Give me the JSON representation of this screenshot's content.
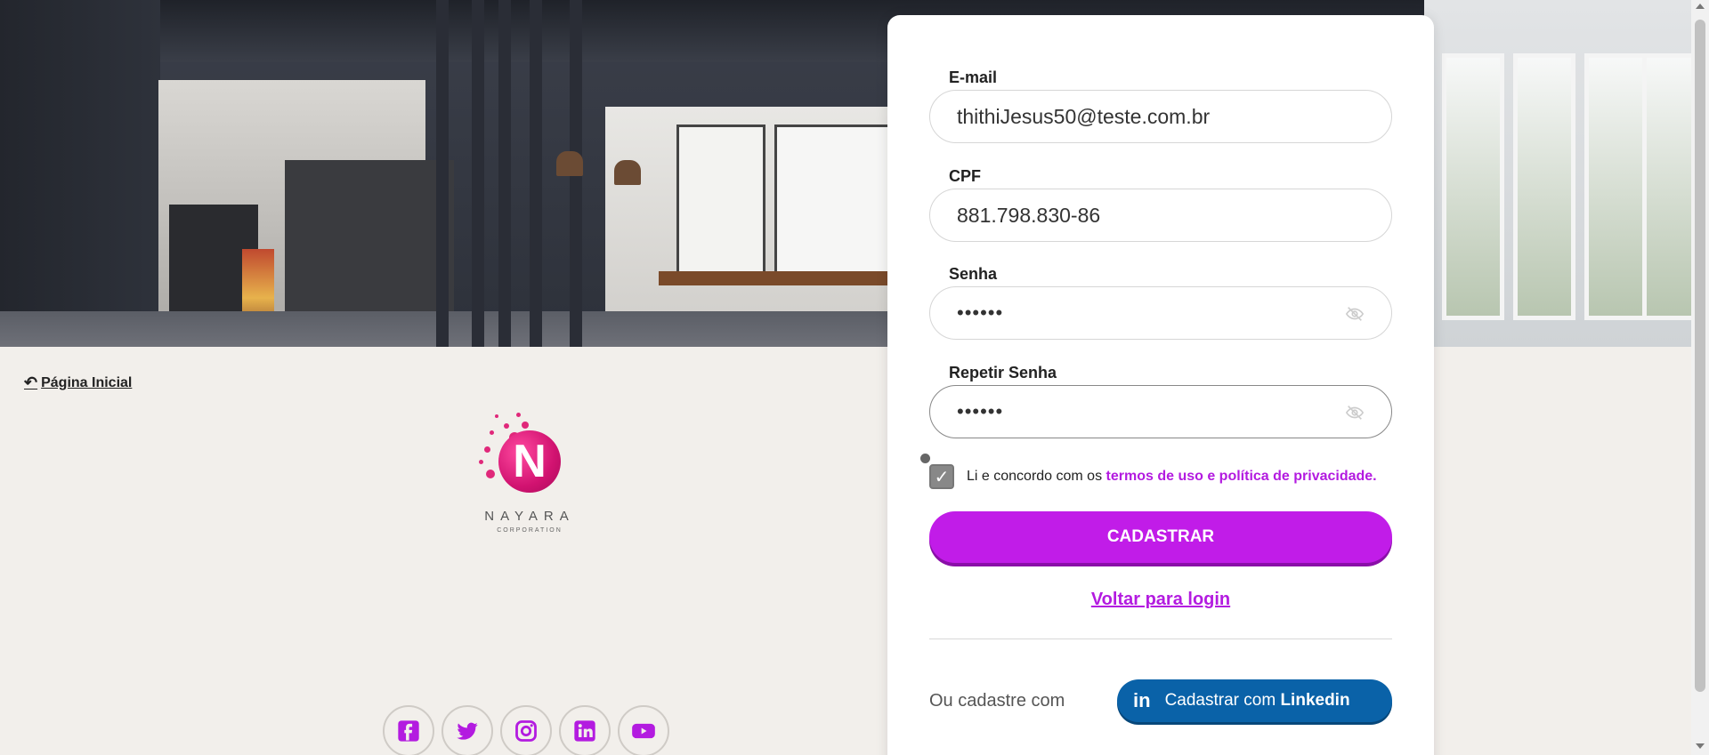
{
  "nav": {
    "home_label": "Página Inicial"
  },
  "brand": {
    "name": "NAYARA",
    "subtitle": "CORPORATION",
    "letter": "N"
  },
  "form": {
    "email": {
      "label": "E-mail",
      "value": "thithiJesus50@teste.com.br"
    },
    "cpf": {
      "label": "CPF",
      "value": "881.798.830-86"
    },
    "password": {
      "label": "Senha",
      "value": "••••••"
    },
    "repeat_password": {
      "label": "Repetir Senha",
      "value": "••••••"
    },
    "agree": {
      "text": "Li e concordo com os",
      "link": "termos de uso e política de privacidade.",
      "checked": true
    },
    "submit_label": "CADASTRAR",
    "back_login_label": "Voltar para login",
    "or_label": "Ou cadastre com",
    "linkedin": {
      "prefix": "Cadastrar com",
      "brand": "Linkedin",
      "icon": "in"
    }
  },
  "socials": [
    "facebook-icon",
    "twitter-icon",
    "instagram-icon",
    "linkedin-icon",
    "youtube-icon"
  ],
  "colors": {
    "accent": "#c11ce8",
    "linkedin": "#0a62a8",
    "background": "#f2efeb"
  }
}
